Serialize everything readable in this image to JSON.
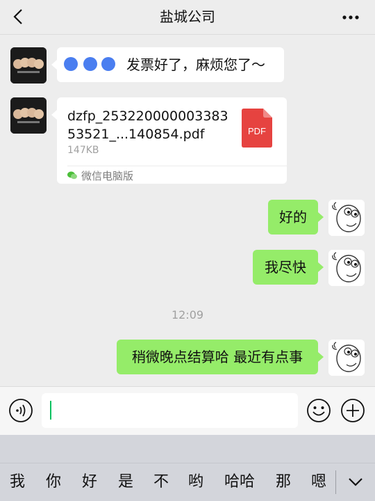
{
  "header": {
    "title": "盐城公司",
    "back_icon": "chevron-left-icon",
    "more_icon": "more-dots-icon"
  },
  "messages": [
    {
      "from": "them",
      "text": "发票好了，麻烦您了～",
      "redacted_name": true
    },
    {
      "from": "them",
      "type": "file",
      "file_name": "dzfp_25322000000338353521_...140854.pdf",
      "file_size": "147KB",
      "file_badge": "PDF",
      "source": "微信电脑版"
    },
    {
      "from": "me",
      "text": "好的"
    },
    {
      "from": "me",
      "text": "我尽快"
    },
    {
      "from": "me",
      "text": "稍微晚点结算哈 最近有点事"
    }
  ],
  "timestamp": "12:09",
  "input": {
    "value": "",
    "placeholder": ""
  },
  "keyboard": {
    "suggestions": [
      "我",
      "你",
      "好",
      "是",
      "不",
      "哟",
      "哈哈",
      "那",
      "嗯"
    ]
  },
  "colors": {
    "self_bubble": "#95ec69",
    "other_bubble": "#ffffff",
    "background": "#ededed",
    "pdf_red": "#e64340",
    "caret": "#07c160"
  }
}
